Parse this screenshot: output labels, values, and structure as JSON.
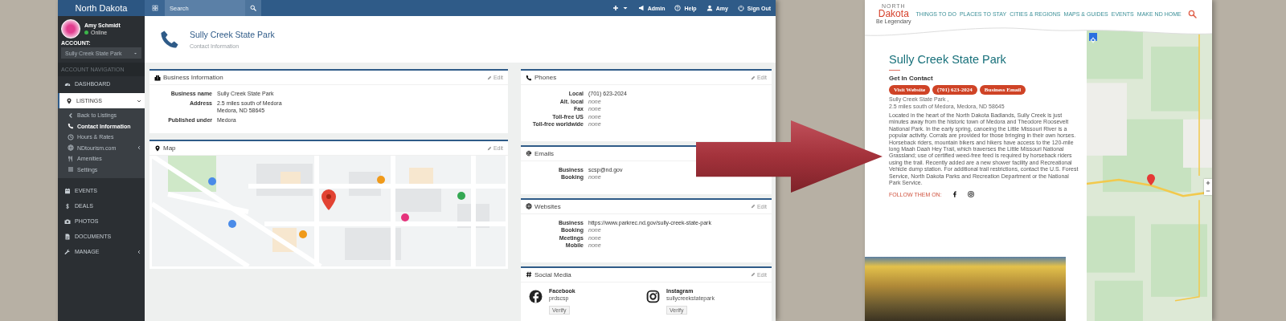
{
  "admin": {
    "brand": "North Dakota",
    "search": {
      "placeholder": "Search"
    },
    "top_nav": [
      {
        "label": "Admin"
      },
      {
        "label": "Help"
      },
      {
        "label": "Amy"
      },
      {
        "label": "Sign Out"
      }
    ],
    "user": {
      "name": "Amy Schmidt",
      "status": "Online",
      "online": true
    },
    "account": {
      "label": "ACCOUNT:",
      "value": "Sully Creek State Park"
    },
    "nav_heading": "ACCOUNT NAVIGATION",
    "nav": [
      {
        "label": "DASHBOARD",
        "kind": "link",
        "selected": false
      },
      {
        "label": "LISTINGS",
        "kind": "group",
        "selected": true,
        "expanded": true,
        "children": [
          {
            "label": "Back to Listings",
            "kind": "link",
            "selected": false
          },
          {
            "label": "Contact Information",
            "kind": "link",
            "selected": true
          },
          {
            "label": "Hours & Rates",
            "kind": "link",
            "selected": false
          },
          {
            "label": "NDtourism.com",
            "kind": "group",
            "selected": false,
            "expanded": false
          },
          {
            "label": "Amenities",
            "kind": "link",
            "selected": false
          },
          {
            "label": "Settings",
            "kind": "link",
            "selected": false
          }
        ]
      },
      {
        "label": "EVENTS",
        "kind": "link",
        "selected": false
      },
      {
        "label": "DEALS",
        "kind": "link",
        "selected": false
      },
      {
        "label": "PHOTOS",
        "kind": "link",
        "selected": false
      },
      {
        "label": "DOCUMENTS",
        "kind": "link",
        "selected": false
      },
      {
        "label": "MANAGE",
        "kind": "group",
        "selected": false,
        "expanded": false
      }
    ],
    "page": {
      "title": "Sully Creek State Park",
      "subtitle": "Contact Information"
    },
    "left_column": {
      "cards": [
        {
          "kind": "business",
          "title": "Business Information",
          "edit": "Edit",
          "rows": [
            {
              "label": "Business name",
              "lines": [
                "Sully Creek State Park"
              ],
              "empty": false
            },
            {
              "label": "Address",
              "lines": [
                "2.5 miles south of Medora",
                "Medora, ND 58645"
              ],
              "empty": false
            },
            {
              "label": "Published under",
              "lines": [
                "Medora"
              ],
              "empty": false
            }
          ]
        },
        {
          "kind": "map",
          "title": "Map",
          "edit": "Edit"
        }
      ]
    },
    "right_column": {
      "cards": [
        {
          "kind": "phones",
          "title": "Phones",
          "edit": "Edit",
          "rows": [
            {
              "label": "Local",
              "lines": [
                "(701) 623-2024"
              ],
              "empty": false
            },
            {
              "label": "Alt. local",
              "lines": [
                "none"
              ],
              "empty": true
            },
            {
              "label": "Fax",
              "lines": [
                "none"
              ],
              "empty": true
            },
            {
              "label": "Toll-free US",
              "lines": [
                "none"
              ],
              "empty": true
            },
            {
              "label": "Toll-free worldwide",
              "lines": [
                "none"
              ],
              "empty": true
            }
          ]
        },
        {
          "kind": "emails",
          "title": "Emails",
          "rows": [
            {
              "label": "Business",
              "lines": [
                "scsp@nd.gov"
              ],
              "empty": false
            },
            {
              "label": "Booking",
              "lines": [
                "none"
              ],
              "empty": true
            }
          ]
        },
        {
          "kind": "websites",
          "title": "Websites",
          "edit": "Edit",
          "rows": [
            {
              "label": "Business",
              "lines": [
                "https://www.parkrec.nd.gov/sully-creek-state-park"
              ],
              "empty": false
            },
            {
              "label": "Booking",
              "lines": [
                "none"
              ],
              "empty": true
            },
            {
              "label": "Meetings",
              "lines": [
                "none"
              ],
              "empty": true
            },
            {
              "label": "Mobile",
              "lines": [
                "none"
              ],
              "empty": true
            }
          ]
        },
        {
          "kind": "social",
          "title": "Social Media",
          "edit": "Edit",
          "accounts": [
            {
              "kind": "facebook",
              "name": "Facebook",
              "handle": "prdscsp",
              "action": "Verify"
            },
            {
              "kind": "instagram",
              "name": "Instagram",
              "handle": "sullycreekstatepark",
              "action": "Verify"
            }
          ]
        }
      ]
    }
  },
  "site": {
    "logo": {
      "top": "NORTH",
      "name": "Dakota",
      "tagline": "Be Legendary"
    },
    "nav": [
      "THINGS TO DO",
      "PLACES TO STAY",
      "CITIES & REGIONS",
      "MAPS & GUIDES",
      "EVENTS",
      "MAKE ND HOME"
    ],
    "title": "Sully Creek State Park",
    "section": "Get In Contact",
    "buttons": [
      "Visit Website",
      "(701) 623-2024",
      "Business Email"
    ],
    "address": [
      "Sully Creek State Park ,",
      "2.5 miles south of Medora, Medora, ND 58645"
    ],
    "description": "Located in the heart of the North Dakota Badlands, Sully Creek is just minutes away from the historic town of Medora and Theodore Roosevelt National Park. In the early spring, canoeing the Little Missouri River is a popular activity. Corrals are provided for those bringing in their own horses. Horseback riders, mountain bikers and hikers have access to the 120-mile long Maah Daah Hey Trail, which traverses the Little Missouri National Grassland; use of certified weed-free feed is required by horseback riders using the trail. Recently added are a new shower facility and Recreational Vehicle dump station. For additional trail restrictions, contact the U.S. Forest Service, North Dakota Parks and Recreation Department or the National Park Service.",
    "follow": "FOLLOW THEM ON:"
  }
}
